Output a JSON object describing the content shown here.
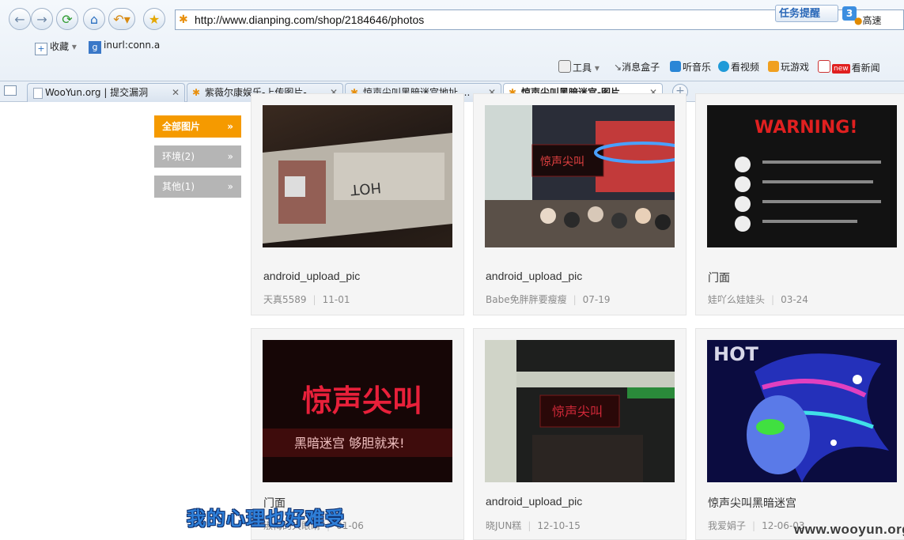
{
  "browser": {
    "url": "http://www.dianping.com/shop/2184646/photos",
    "task_reminder": "任务提醒",
    "task_count": "3",
    "speed_mode": "高速",
    "favorites": [
      {
        "label": "收藏",
        "icon": "favorites-icon"
      },
      {
        "label": "inurl:conn.a",
        "icon": "google-icon"
      }
    ],
    "toolbar": [
      {
        "label": "工具",
        "icon": "tools-icon"
      },
      {
        "label": "消息盒子",
        "icon": "message-box-icon"
      },
      {
        "label": "听音乐",
        "icon": "music-icon"
      },
      {
        "label": "看视频",
        "icon": "video-icon"
      },
      {
        "label": "玩游戏",
        "icon": "game-icon"
      },
      {
        "label": "看新闻",
        "icon": "news-icon",
        "badge": "new"
      }
    ],
    "tabs": [
      {
        "label": "WooYun.org | 提交漏洞",
        "active": false
      },
      {
        "label": "紫薇尔康娱乐-上传图片-...",
        "active": false
      },
      {
        "label": "惊声尖叫黑暗迷宫地址,...",
        "active": false
      },
      {
        "label": "惊声尖叫黑暗迷宫-图片...",
        "active": true
      }
    ]
  },
  "filters": [
    {
      "label": "全部图片",
      "active": true
    },
    {
      "label": "环境(2)",
      "active": false
    },
    {
      "label": "其他(1)",
      "active": false
    }
  ],
  "photos": [
    {
      "caption": "android_upload_pic",
      "user": "天真5589",
      "date": "11-01"
    },
    {
      "caption": "android_upload_pic",
      "user": "Babe免胖胖要瘦瘦",
      "date": "07-19"
    },
    {
      "caption": "门面",
      "user": "娃吖么娃娃头",
      "date": "03-24"
    },
    {
      "caption": "门面",
      "user": "淑梅的大眼睛",
      "date": "01-06"
    },
    {
      "caption": "android_upload_pic",
      "user": "晓JUN糕",
      "date": "12-10-15"
    },
    {
      "caption": "惊声尖叫黑暗迷宫",
      "user": "我爱娟子",
      "date": "12-06-03"
    }
  ],
  "photo_text": {
    "warning": "WARNING!",
    "sign": "惊声尖叫",
    "subsign": "黑暗迷宫 够胆就来!",
    "hot": "HOT"
  },
  "watermark": {
    "left": "我的心理也好难受",
    "right": "www.wooyun.org"
  },
  "colors": {
    "filter_active": "#f59a00",
    "filter_inactive": "#b5b5b5",
    "link_blue": "#2a6fc0"
  }
}
